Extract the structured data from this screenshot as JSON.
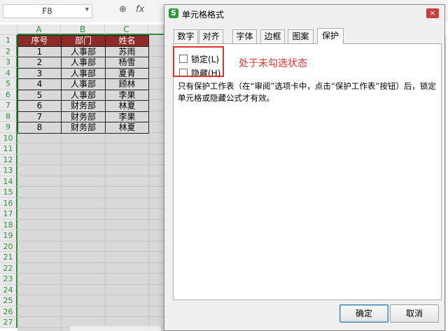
{
  "formula_bar": {
    "cell_reference": "F8",
    "zoom_icon": "zoom-icon",
    "fx_label": "fx"
  },
  "sheet": {
    "columns": [
      "A",
      "B",
      "C"
    ],
    "row_numbers": [
      "1",
      "2",
      "3",
      "4",
      "5",
      "6",
      "7",
      "8",
      "9",
      "10",
      "11",
      "12",
      "13",
      "14",
      "15",
      "16",
      "17",
      "18",
      "19",
      "20",
      "21",
      "22",
      "23",
      "24",
      "25",
      "26",
      "27"
    ],
    "headers": [
      "序号",
      "部门",
      "姓名"
    ],
    "rows": [
      [
        "1",
        "人事部",
        "苏雨"
      ],
      [
        "2",
        "人事部",
        "杨雪"
      ],
      [
        "3",
        "人事部",
        "夏青"
      ],
      [
        "4",
        "人事部",
        "顾林"
      ],
      [
        "5",
        "人事部",
        "李果"
      ],
      [
        "6",
        "财务部",
        "林夏"
      ],
      [
        "7",
        "财务部",
        "李果"
      ],
      [
        "8",
        "财务部",
        "林夏"
      ]
    ],
    "header_color": "#8b2a26",
    "accent_color": "#2f8f3f"
  },
  "dialog": {
    "title": "单元格格式",
    "app_icon_letter": "S",
    "close_label": "×",
    "tabs": [
      {
        "label": "数字",
        "active": false
      },
      {
        "label": "对齐",
        "active": false
      },
      {
        "label": "字体",
        "active": false
      },
      {
        "label": "边框",
        "active": false
      },
      {
        "label": "图案",
        "active": false
      },
      {
        "label": "保护",
        "active": true
      }
    ],
    "protection": {
      "locked_label": "锁定(L)",
      "locked_checked": false,
      "hidden_label": "隐藏(H)",
      "hidden_checked": false,
      "info_text": "只有保护工作表（在“审阅”选项卡中，点击“保护工作表”按钮）后，锁定单元格或隐藏公式才有效。"
    },
    "annotation": "处于未勾选状态",
    "ok_label": "确定",
    "cancel_label": "取消",
    "annotation_color": "#e0312d"
  }
}
